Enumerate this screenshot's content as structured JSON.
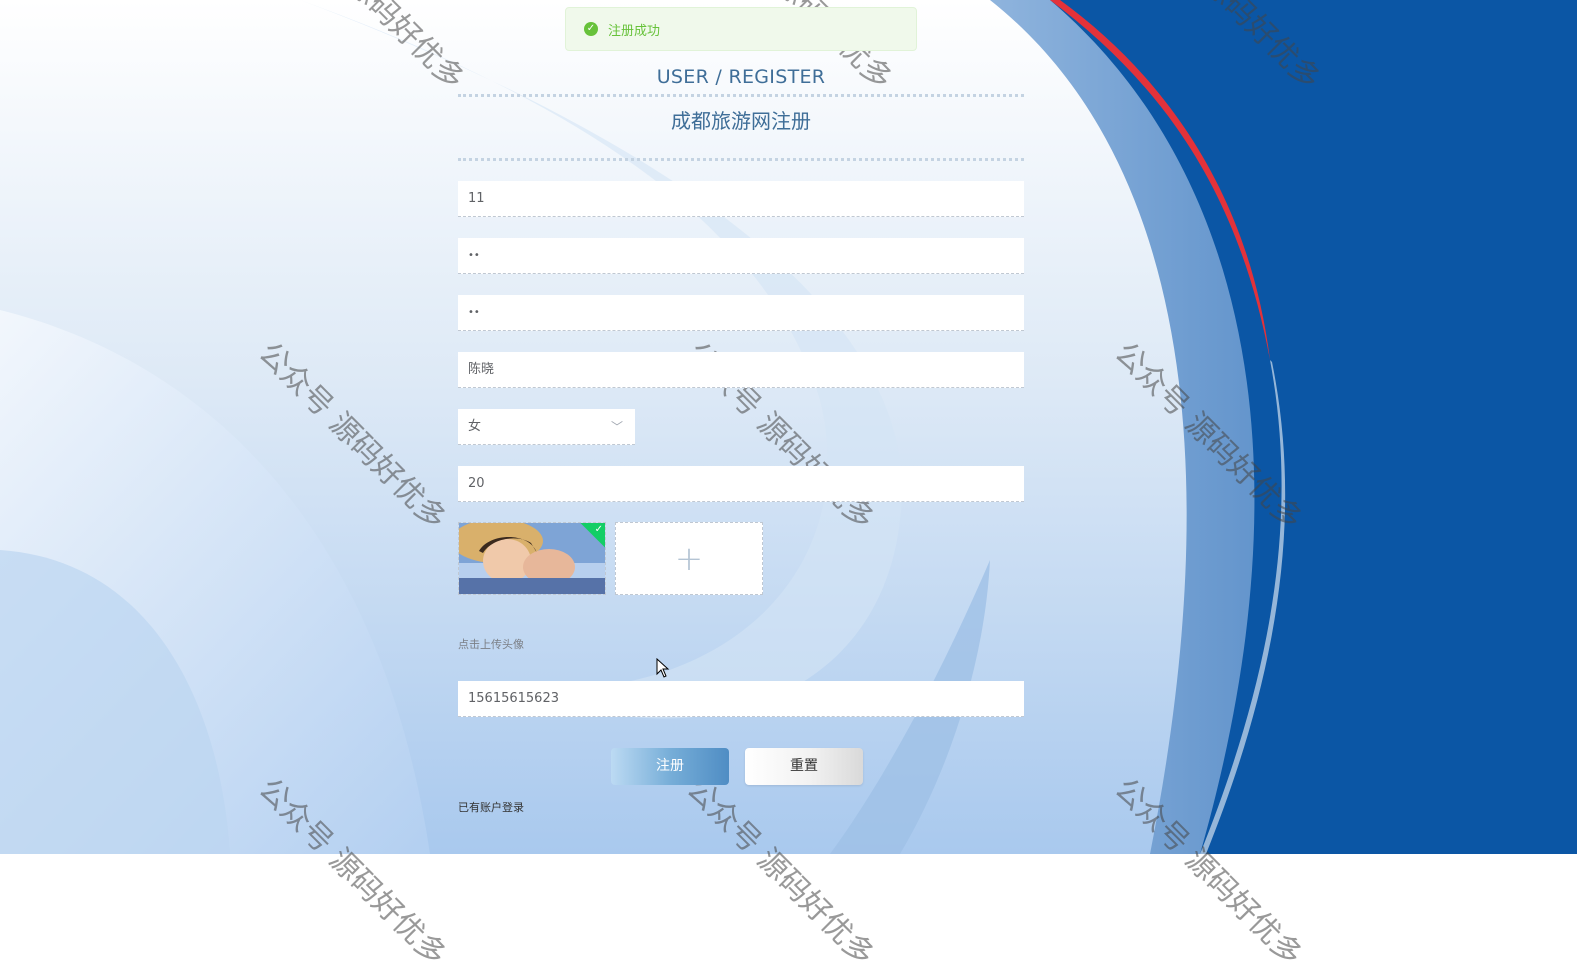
{
  "colors": {
    "primary_blue": "#3f6e98",
    "success_green": "#67c23a",
    "deep_blue": "#0b56a5",
    "accent_red": "#e3323a"
  },
  "toast": {
    "icon": "check-circle-icon",
    "message": "注册成功"
  },
  "header": {
    "en_title": "USER / REGISTER",
    "cn_title": "成都旅游网注册"
  },
  "form": {
    "account": "11",
    "password": "••",
    "confirm_password": "••",
    "name": "陈晓",
    "gender": "女",
    "age": "20",
    "upload_add_icon": "plus-icon",
    "upload_hint": "点击上传头像",
    "phone": "15615615623"
  },
  "buttons": {
    "register": "注册",
    "reset": "重置"
  },
  "links": {
    "login": "已有账户登录"
  },
  "watermark": {
    "text": "公众号 源码好优多"
  }
}
